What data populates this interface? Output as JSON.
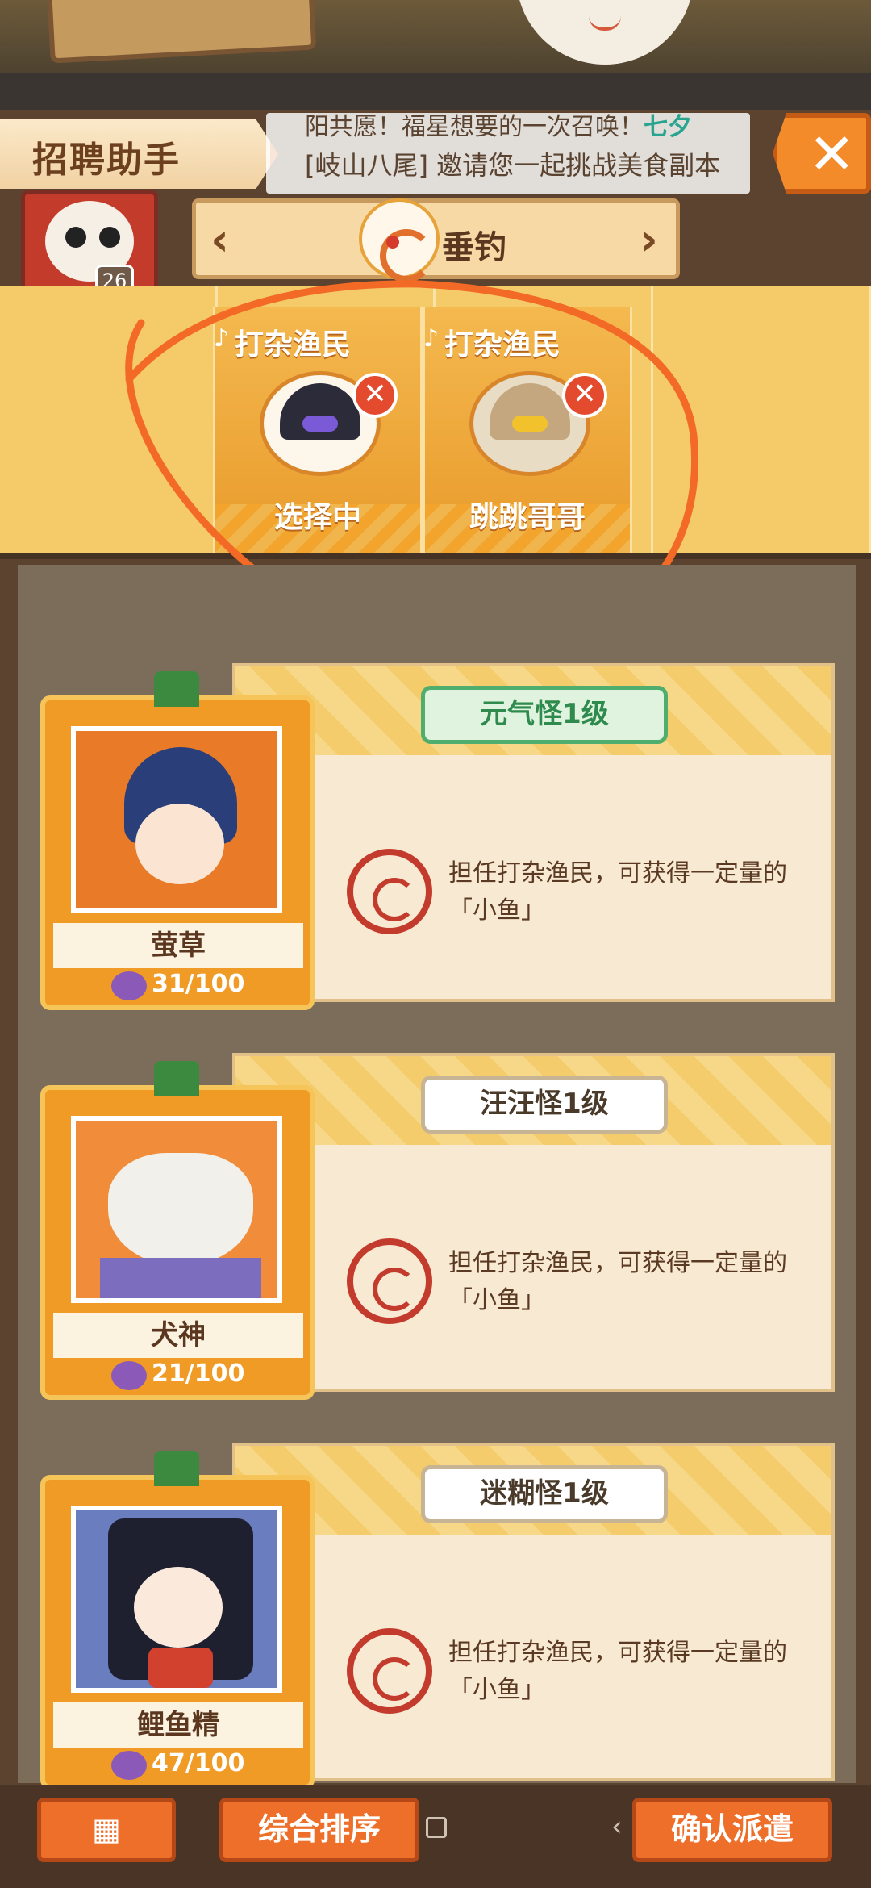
{
  "header": {
    "title": "招聘助手",
    "ticker_line1": "阳共愿！福星想要的一次召唤！",
    "ticker_line1_tag": "七夕",
    "ticker_line2": "[岐山八尾] 邀请您一起挑战美食副本",
    "close_symbol": "✕"
  },
  "player": {
    "level": "26"
  },
  "category": {
    "label": "垂钓",
    "prev_symbol": "‹",
    "next_symbol": "›"
  },
  "slots": [
    {
      "role": "打杂渔民",
      "name": "选择中",
      "remove_symbol": "✕"
    },
    {
      "role": "打杂渔民",
      "name": "跳跳哥哥",
      "remove_symbol": "✕"
    }
  ],
  "candidates": [
    {
      "name": "萤草",
      "stat": "31/100",
      "tag": "元气怪1级",
      "desc": "担任打杂渔民，可获得一定量的「小鱼」",
      "tag_active": true,
      "theme": "#e87a28"
    },
    {
      "name": "犬神",
      "stat": "21/100",
      "tag": "汪汪怪1级",
      "desc": "担任打杂渔民，可获得一定量的「小鱼」",
      "tag_active": false,
      "theme": "#f08c3a"
    },
    {
      "name": "鲤鱼精",
      "stat": "47/100",
      "tag": "迷糊怪1级",
      "desc": "担任打杂渔民，可获得一定量的「小鱼」",
      "tag_active": false,
      "theme": "#6a7dbf"
    }
  ],
  "bottom_bar": {
    "grid_symbol": "▦",
    "sort_label": "综合排序",
    "confirm_label": "确认派遣",
    "back_symbol": "‹"
  },
  "colors": {
    "accent": "#ee6f2a",
    "annotation": "#f26a25",
    "tag_active": "#2e8a4d"
  }
}
